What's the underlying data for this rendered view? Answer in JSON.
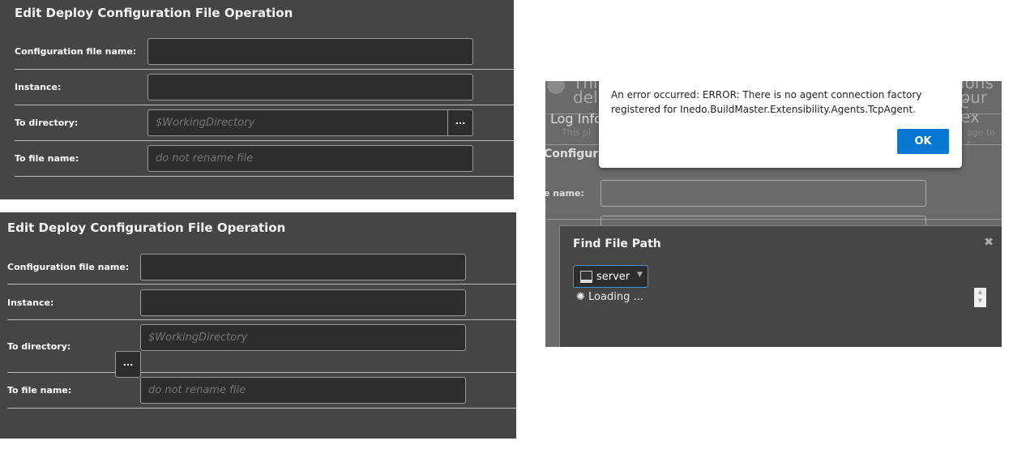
{
  "panel1": {
    "title": "Edit Deploy Configuration File Operation",
    "fields": [
      {
        "label": "Configuration file name:",
        "value": "",
        "placeholder": ""
      },
      {
        "label": "Instance:",
        "value": "",
        "placeholder": ""
      },
      {
        "label": "To directory:",
        "value": "",
        "placeholder": "$WorkingDirectory"
      },
      {
        "label": "To file name:",
        "value": "",
        "placeholder": "do not rename file"
      }
    ],
    "browse_label": "..."
  },
  "panel2": {
    "title": "Edit Deploy Configuration File Operation",
    "fields": [
      {
        "label": "Configuration file name:",
        "value": "",
        "placeholder": ""
      },
      {
        "label": "Instance:",
        "value": "",
        "placeholder": ""
      },
      {
        "label": "To directory:",
        "value": "",
        "placeholder": "$WorkingDirectory"
      },
      {
        "label": "To file name:",
        "value": "",
        "placeholder": "do not rename file"
      }
    ],
    "browse_label": "..."
  },
  "panel3": {
    "background": {
      "line1a": "Thi",
      "line2a": "del",
      "line1b": "ions c",
      "line2b": "our ex",
      "log": "Log Info",
      "info_a": "This pl",
      "info_b": "age to r",
      "section": "Configura",
      "field_label": "e name:"
    },
    "alert": {
      "message": "An error occurred: ERROR: There is no agent connection factory registered for Inedo.BuildMaster.Extensibility.Agents.TcpAgent.",
      "ok_label": "OK",
      "accent": "#0a78d2"
    },
    "dialog": {
      "title": "Find File Path",
      "server_select": "server",
      "loading": "Loading ...",
      "close_icon": "close-icon"
    }
  }
}
